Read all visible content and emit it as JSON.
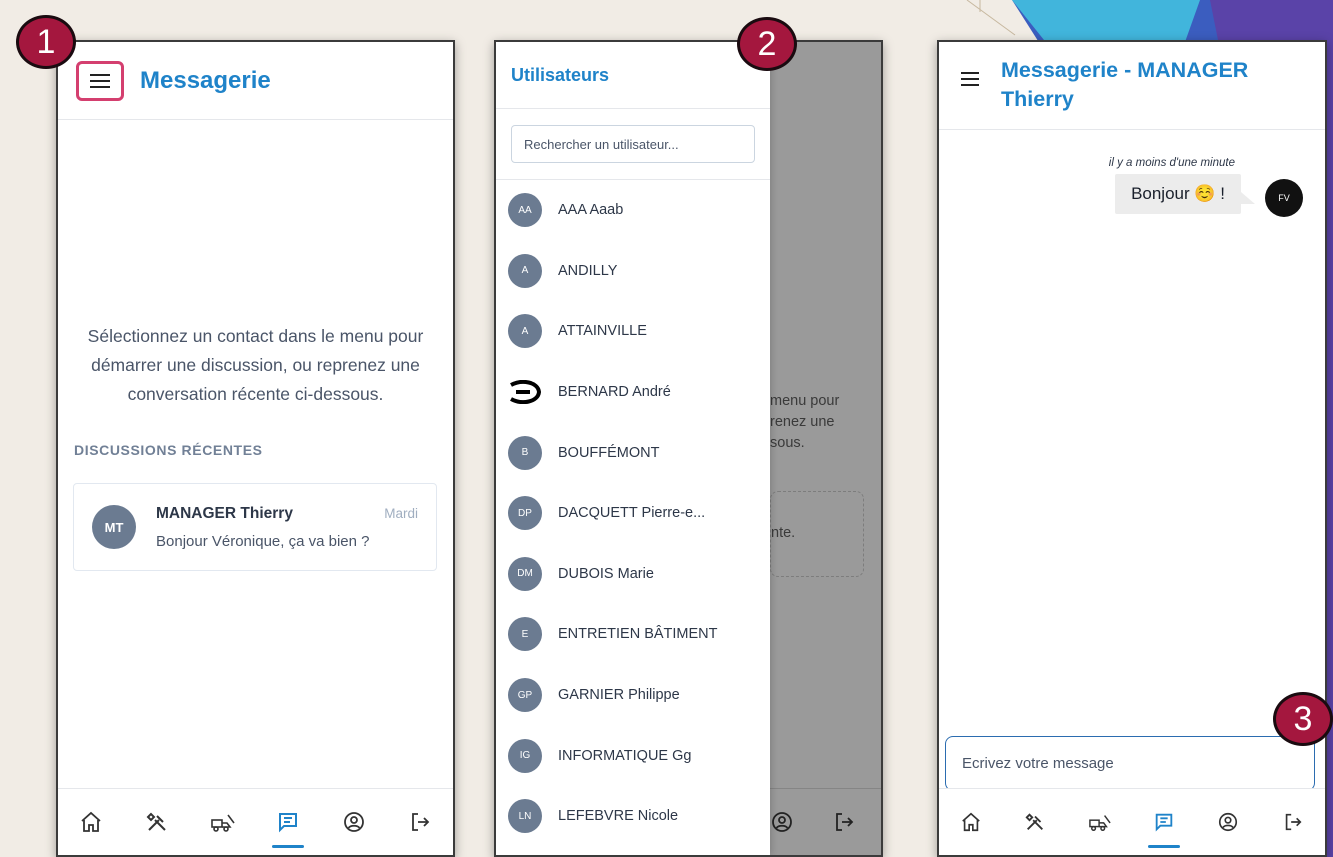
{
  "steps": [
    "1",
    "2",
    "3"
  ],
  "screen1": {
    "title": "Messagerie",
    "menu_icon": "hamburger-icon",
    "empty_text_lines": [
      "Sélectionnez un contact dans le menu pour",
      "démarrer une discussion, ou reprenez une",
      "conversation récente ci-dessous."
    ],
    "section_label": "DISCUSSIONS RÉCENTES",
    "recent": {
      "initials": "MT",
      "name": "MANAGER Thierry",
      "day": "Mardi",
      "last_message": "Bonjour Véronique, ça va bien ?"
    }
  },
  "screen2": {
    "drawer_title": "Utilisateurs",
    "search_placeholder": "Rechercher un utilisateur...",
    "users": [
      {
        "initials": "AA",
        "name": "AAA Aaab"
      },
      {
        "initials": "A",
        "name": "ANDILLY"
      },
      {
        "initials": "A",
        "name": "ATTAINVILLE"
      },
      {
        "initials": "",
        "name": "BERNARD André",
        "avatar_icon": "custom-logo-icon"
      },
      {
        "initials": "B",
        "name": "BOUFFÉMONT"
      },
      {
        "initials": "DP",
        "name": "DACQUETT Pierre-e..."
      },
      {
        "initials": "DM",
        "name": "DUBOIS Marie"
      },
      {
        "initials": "E",
        "name": "ENTRETIEN BÂTIMENT"
      },
      {
        "initials": "GP",
        "name": "GARNIER Philippe"
      },
      {
        "initials": "IG",
        "name": "INFORMATIQUE Gg"
      },
      {
        "initials": "LN",
        "name": "LEFEBVRE Nicole"
      }
    ],
    "behind_text_lines": [
      "menu pour",
      "renez une",
      "sous."
    ],
    "behind_box_text": "nte."
  },
  "screen3": {
    "title_line1": "Messagerie - MANAGER",
    "title_line2": "Thierry",
    "message_time": "il y a moins d'une minute",
    "message_text": "Bonjour ☺️ !",
    "sender_initials": "FV",
    "compose_placeholder": "Ecrivez votre message"
  },
  "nav_items": [
    "home-icon",
    "tools-icon",
    "vehicles-icon",
    "messages-icon",
    "profile-icon",
    "logout-icon"
  ],
  "colors": {
    "accent": "#1f83c9",
    "avatar": "#6b7b91",
    "step_badge": "#a4173e",
    "menu_highlight": "#d43f6f"
  }
}
